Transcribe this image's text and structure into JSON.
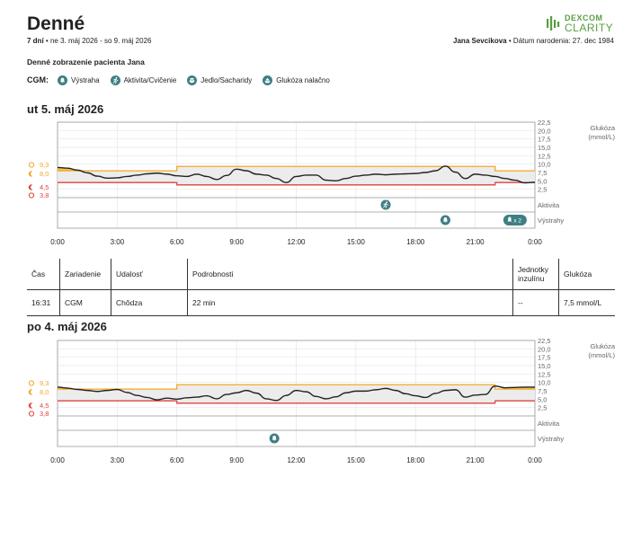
{
  "header": {
    "title": "Denné",
    "range_days": "7 dní",
    "range_sep": "•",
    "range_dates": "ne 3. máj 2026 - so 9. máj 2026",
    "patient_name": "Jana Sevcikova",
    "patient_sep": "•",
    "patient_birth": "Dátum narodenia: 27. dec 1984",
    "logo_top": "DEXCOM",
    "logo_bottom": "CLARITY"
  },
  "subtitle": "Denné zobrazenie pacienta Jana",
  "legend": {
    "cgm_label": "CGM:",
    "items": [
      {
        "label": "Výstraha",
        "icon": "bell-icon"
      },
      {
        "label": "Aktivita/Cvičenie",
        "icon": "runner-icon"
      },
      {
        "label": "Jedlo/Sacharidy",
        "icon": "meal-icon"
      },
      {
        "label": "Glukóza nalačno",
        "icon": "fasting-icon"
      }
    ]
  },
  "colors": {
    "high": "#f5a623",
    "low": "#e0433b",
    "icon": "#3e7f84",
    "trace": "#222222",
    "high_fill": "#f0c44c"
  },
  "day1": {
    "title": "ut 5. máj 2026",
    "threshold_labels": [
      "9,3",
      "8,0",
      "4,5",
      "3,8"
    ],
    "y_axis_labels": [
      "22,5",
      "20,0",
      "17,5",
      "15,0",
      "12,5",
      "10,0",
      "7,5",
      "5,0",
      "2,5"
    ],
    "y_unit_1": "Glukóza",
    "y_unit_2": "(mmol/L)",
    "lane_activity": "Aktivita",
    "lane_alerts": "Výstrahy",
    "x_ticks": [
      "0:00",
      "3:00",
      "6:00",
      "9:00",
      "12:00",
      "15:00",
      "18:00",
      "21:00",
      "0:00"
    ],
    "alert_group_count": "x 2",
    "table": {
      "headers": [
        "Čas",
        "Zariadenie",
        "Udalosť",
        "Podrobnosti",
        "Jednotky inzulínu",
        "Glukóza"
      ],
      "rows": [
        [
          "16:31",
          "CGM",
          "Chôdza",
          "22 min",
          "--",
          "7,5 mmol/L"
        ]
      ]
    }
  },
  "day2": {
    "title": "po 4. máj 2026",
    "threshold_labels": [
      "9,3",
      "8,0",
      "4,5",
      "3,8"
    ],
    "y_axis_labels": [
      "22,5",
      "20,0",
      "17,5",
      "15,0",
      "12,5",
      "10,0",
      "7,5",
      "5,0",
      "2,5"
    ],
    "y_unit_1": "Glukóza",
    "y_unit_2": "(mmol/L)",
    "lane_activity": "Aktivita",
    "lane_alerts": "Výstrahy",
    "x_ticks": [
      "0:00",
      "3:00",
      "6:00",
      "9:00",
      "12:00",
      "15:00",
      "18:00",
      "21:00",
      "0:00"
    ]
  },
  "chart_data": [
    {
      "type": "line",
      "title": "ut 5. máj 2026",
      "xlabel": "",
      "ylabel": "Glukóza (mmol/L)",
      "ylim": [
        0,
        22.5
      ],
      "x_unit": "hours",
      "high_target": [
        {
          "from": 0,
          "to": 6,
          "value": 8.0
        },
        {
          "from": 6,
          "to": 22,
          "value": 9.3
        },
        {
          "from": 22,
          "to": 24,
          "value": 8.0
        }
      ],
      "low_target": [
        {
          "from": 0,
          "to": 6,
          "value": 4.5
        },
        {
          "from": 6,
          "to": 22,
          "value": 3.8
        },
        {
          "from": 22,
          "to": 24,
          "value": 4.5
        }
      ],
      "series": [
        {
          "x": [
            0,
            0.5,
            1,
            1.5,
            2,
            2.5,
            3,
            3.5,
            4,
            4.5,
            5,
            5.5,
            6,
            6.5,
            7,
            7.5,
            8,
            8.5,
            9,
            9.5,
            10,
            10.5,
            11,
            11.5,
            12,
            12.5,
            13,
            13.5,
            14,
            14.5,
            15,
            15.5,
            16,
            16.5,
            17,
            17.5,
            18,
            18.5,
            19,
            19.5,
            20,
            20.5,
            21,
            21.5,
            22,
            22.5,
            23,
            23.5,
            24
          ],
          "y": [
            9.0,
            8.8,
            8.2,
            7.4,
            6.4,
            5.8,
            5.9,
            6.3,
            6.7,
            7.1,
            7.3,
            7.0,
            6.5,
            6.3,
            7.0,
            6.3,
            5.4,
            6.6,
            8.5,
            8.0,
            7.0,
            6.7,
            5.7,
            4.5,
            6.3,
            6.7,
            6.7,
            5.2,
            5.0,
            5.7,
            6.4,
            6.7,
            7.0,
            6.8,
            7.0,
            7.1,
            7.2,
            7.5,
            8.0,
            9.4,
            7.6,
            5.7,
            7.0,
            6.7,
            6.3,
            5.7,
            5.2,
            4.4,
            4.6
          ]
        }
      ]
    },
    {
      "type": "line",
      "title": "po 4. máj 2026",
      "xlabel": "",
      "ylabel": "Glukóza (mmol/L)",
      "ylim": [
        0,
        22.5
      ],
      "x_unit": "hours",
      "high_target": [
        {
          "from": 0,
          "to": 6,
          "value": 8.0
        },
        {
          "from": 6,
          "to": 22,
          "value": 9.3
        },
        {
          "from": 22,
          "to": 24,
          "value": 8.0
        }
      ],
      "low_target": [
        {
          "from": 0,
          "to": 6,
          "value": 4.5
        },
        {
          "from": 6,
          "to": 22,
          "value": 3.8
        },
        {
          "from": 22,
          "to": 24,
          "value": 4.5
        }
      ],
      "series": [
        {
          "x": [
            0,
            0.5,
            1,
            1.5,
            2,
            2.5,
            3,
            3.5,
            4,
            4.5,
            5,
            5.5,
            6,
            6.5,
            7,
            7.5,
            8,
            8.5,
            9,
            9.5,
            10,
            10.5,
            11,
            11.5,
            12,
            12.5,
            13,
            13.5,
            14,
            14.5,
            15,
            15.5,
            16,
            16.5,
            17,
            17.5,
            18,
            18.5,
            19,
            19.5,
            20,
            20.5,
            21,
            21.5,
            22,
            22.5,
            23,
            23.5,
            24
          ],
          "y": [
            8.6,
            8.3,
            7.9,
            7.6,
            7.3,
            7.6,
            7.9,
            7.0,
            6.1,
            5.5,
            4.8,
            5.3,
            5.0,
            5.4,
            5.6,
            6.0,
            5.1,
            6.4,
            6.9,
            7.6,
            6.8,
            5.1,
            4.6,
            6.1,
            7.6,
            7.2,
            5.8,
            5.1,
            5.7,
            6.9,
            7.4,
            7.4,
            7.8,
            8.2,
            7.6,
            6.6,
            6.0,
            5.5,
            6.7,
            7.6,
            7.8,
            5.6,
            6.2,
            6.4,
            8.9,
            8.4,
            8.5,
            8.6,
            8.6
          ]
        }
      ]
    }
  ]
}
